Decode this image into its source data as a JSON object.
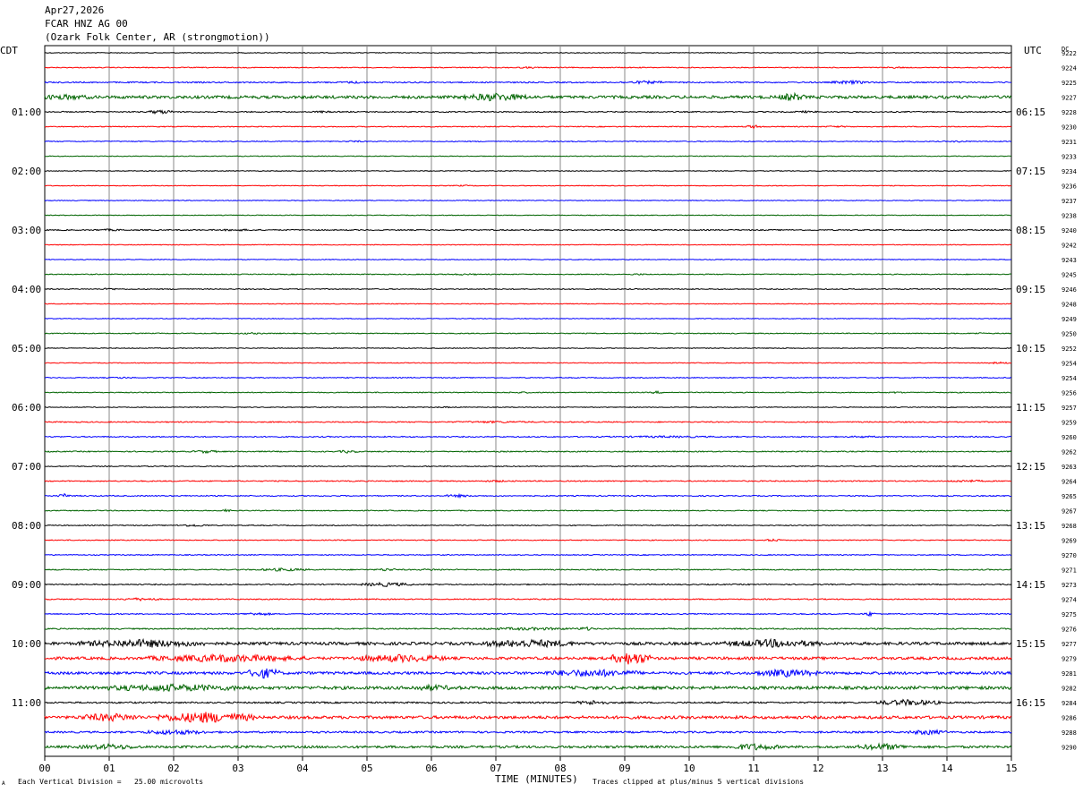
{
  "header": {
    "date": "Apr27,2026",
    "station": "FCAR HNZ AG 00",
    "location": "(Ozark Folk Center, AR (strongmotion))"
  },
  "left_timezone": "CDT",
  "right_timezone": "UTC",
  "dc_label": "DC",
  "footer": {
    "xlabel": "TIME (MINUTES)",
    "scale_note": "Each Vertical Division =   25.00 microvolts",
    "clip_note": "Traces clipped at plus/minus 5 vertical divisions",
    "corner_mark": "A"
  },
  "colors": {
    "trace_cycle": [
      "#000000",
      "#ff0000",
      "#0000ff",
      "#006400"
    ],
    "grid": "#888888"
  },
  "chart_data": {
    "type": "line",
    "title": "FCAR HNZ AG 00",
    "xlabel": "TIME (MINUTES)",
    "ylabel": "",
    "xlim": [
      0,
      15
    ],
    "x_ticks": [
      "00",
      "01",
      "02",
      "03",
      "04",
      "05",
      "06",
      "07",
      "08",
      "09",
      "10",
      "11",
      "12",
      "13",
      "14",
      "15"
    ],
    "left_hour_labels": [
      "01:00",
      "02:00",
      "03:00",
      "04:00",
      "05:00",
      "06:00",
      "07:00",
      "08:00",
      "09:00",
      "10:00",
      "11:00"
    ],
    "right_hour_labels": [
      "06:15",
      "07:15",
      "08:15",
      "09:15",
      "10:15",
      "11:15",
      "12:15",
      "13:15",
      "14:15",
      "15:15",
      "16:15"
    ],
    "dc_offsets": [
      "9222",
      "9224",
      "9225",
      "9227",
      "9228",
      "9230",
      "9231",
      "9233",
      "9234",
      "9236",
      "9237",
      "9238",
      "9240",
      "9242",
      "9243",
      "9245",
      "9246",
      "9248",
      "9249",
      "9250",
      "9252",
      "9254",
      "9254",
      "9256",
      "9257",
      "9259",
      "9260",
      "9262",
      "9263",
      "9264",
      "9265",
      "9267",
      "9268",
      "9269",
      "9270",
      "9271",
      "9273",
      "9274",
      "9275",
      "9276",
      "9277",
      "9279",
      "9281",
      "9282",
      "9284",
      "9286",
      "9288",
      "9290"
    ],
    "trace_activity": [
      {
        "base": 0.4,
        "bursts": []
      },
      {
        "base": 0.5,
        "bursts": [
          [
            7.5,
            0.5,
            2
          ],
          [
            13.2,
            0.4,
            2
          ]
        ]
      },
      {
        "base": 0.7,
        "bursts": [
          [
            4.8,
            0.5,
            2
          ],
          [
            9.3,
            0.8,
            2.5
          ],
          [
            12.5,
            0.6,
            3
          ]
        ]
      },
      {
        "base": 1.6,
        "bursts": [
          [
            0.3,
            1.0,
            2
          ],
          [
            7.0,
            1.0,
            3
          ],
          [
            11.6,
            0.4,
            3
          ]
        ]
      },
      {
        "base": 0.6,
        "bursts": [
          [
            1.8,
            0.4,
            4
          ],
          [
            4.3,
            0.4,
            2
          ],
          [
            11.8,
            0.5,
            2
          ]
        ]
      },
      {
        "base": 0.5,
        "bursts": [
          [
            11.0,
            0.3,
            4
          ],
          [
            12.3,
            0.5,
            2
          ]
        ]
      },
      {
        "base": 0.5,
        "bursts": [
          [
            4.8,
            0.4,
            2
          ],
          [
            14.2,
            0.4,
            2
          ]
        ]
      },
      {
        "base": 0.4,
        "bursts": []
      },
      {
        "base": 0.4,
        "bursts": []
      },
      {
        "base": 0.4,
        "bursts": [
          [
            6.5,
            0.5,
            2
          ]
        ]
      },
      {
        "base": 0.4,
        "bursts": []
      },
      {
        "base": 0.4,
        "bursts": []
      },
      {
        "base": 0.6,
        "bursts": [
          [
            1.0,
            0.6,
            2
          ],
          [
            3.0,
            0.8,
            2
          ]
        ]
      },
      {
        "base": 0.4,
        "bursts": []
      },
      {
        "base": 0.4,
        "bursts": []
      },
      {
        "base": 0.5,
        "bursts": [
          [
            6.5,
            0.6,
            2
          ],
          [
            9.2,
            0.3,
            2
          ]
        ]
      },
      {
        "base": 0.5,
        "bursts": [
          [
            1.0,
            0.2,
            3
          ]
        ]
      },
      {
        "base": 0.4,
        "bursts": []
      },
      {
        "base": 0.4,
        "bursts": []
      },
      {
        "base": 0.5,
        "bursts": [
          [
            3.2,
            0.6,
            2
          ],
          [
            14.5,
            0.3,
            2
          ]
        ]
      },
      {
        "base": 0.4,
        "bursts": [
          [
            11.5,
            0.2,
            2
          ]
        ]
      },
      {
        "base": 0.4,
        "bursts": [
          [
            14.8,
            0.3,
            3
          ]
        ]
      },
      {
        "base": 0.5,
        "bursts": [
          [
            1.2,
            0.5,
            2
          ]
        ]
      },
      {
        "base": 0.5,
        "bursts": [
          [
            7.4,
            0.5,
            2
          ],
          [
            9.5,
            0.2,
            3
          ],
          [
            13.2,
            0.3,
            2
          ]
        ]
      },
      {
        "base": 0.4,
        "bursts": [
          [
            6.2,
            0.4,
            2
          ]
        ]
      },
      {
        "base": 0.6,
        "bursts": [
          [
            7.0,
            1.6,
            2
          ]
        ]
      },
      {
        "base": 0.6,
        "bursts": [
          [
            9.6,
            2.0,
            2
          ],
          [
            12.7,
            0.5,
            2
          ]
        ]
      },
      {
        "base": 0.6,
        "bursts": [
          [
            2.5,
            0.4,
            3
          ],
          [
            4.7,
            0.3,
            3
          ]
        ]
      },
      {
        "base": 0.5,
        "bursts": []
      },
      {
        "base": 0.6,
        "bursts": [
          [
            7.0,
            0.5,
            2
          ],
          [
            14.3,
            0.6,
            2.5
          ]
        ]
      },
      {
        "base": 0.6,
        "bursts": [
          [
            0.3,
            0.2,
            4
          ],
          [
            6.4,
            0.4,
            3
          ]
        ]
      },
      {
        "base": 0.5,
        "bursts": [
          [
            2.8,
            0.2,
            3
          ]
        ]
      },
      {
        "base": 0.5,
        "bursts": [
          [
            2.3,
            0.5,
            3
          ]
        ]
      },
      {
        "base": 0.5,
        "bursts": [
          [
            11.3,
            0.3,
            3
          ]
        ]
      },
      {
        "base": 0.5,
        "bursts": []
      },
      {
        "base": 0.6,
        "bursts": [
          [
            3.7,
            0.8,
            3
          ],
          [
            5.3,
            0.3,
            3
          ],
          [
            6.0,
            0.5,
            2
          ]
        ]
      },
      {
        "base": 0.6,
        "bursts": [
          [
            5.3,
            0.8,
            4
          ]
        ]
      },
      {
        "base": 0.6,
        "bursts": [
          [
            1.5,
            0.6,
            3
          ]
        ]
      },
      {
        "base": 0.6,
        "bursts": [
          [
            3.3,
            0.5,
            3
          ],
          [
            12.8,
            0.2,
            4
          ]
        ]
      },
      {
        "base": 0.7,
        "bursts": [
          [
            7.5,
            1.5,
            2.5
          ],
          [
            8.4,
            0.3,
            3
          ]
        ]
      },
      {
        "base": 1.6,
        "bursts": [
          [
            1.5,
            2.0,
            3
          ],
          [
            7.5,
            1.5,
            3
          ],
          [
            11.3,
            1.5,
            3
          ]
        ]
      },
      {
        "base": 1.5,
        "bursts": [
          [
            2.8,
            2.5,
            3
          ],
          [
            5.5,
            1.5,
            3
          ],
          [
            9.1,
            0.6,
            5
          ]
        ]
      },
      {
        "base": 1.5,
        "bursts": [
          [
            3.4,
            0.5,
            4
          ],
          [
            8.5,
            1.5,
            3
          ],
          [
            11.5,
            1.0,
            3
          ]
        ]
      },
      {
        "base": 1.7,
        "bursts": [
          [
            2.0,
            2.5,
            2.5
          ],
          [
            6.0,
            1.0,
            2
          ]
        ]
      },
      {
        "base": 0.9,
        "bursts": [
          [
            8.5,
            0.5,
            3
          ],
          [
            13.4,
            1.0,
            4
          ]
        ]
      },
      {
        "base": 1.6,
        "bursts": [
          [
            1.0,
            1.0,
            3
          ],
          [
            2.5,
            1.5,
            4
          ]
        ]
      },
      {
        "base": 1.0,
        "bursts": [
          [
            2.0,
            1.0,
            3
          ],
          [
            13.7,
            0.6,
            3
          ]
        ]
      },
      {
        "base": 1.3,
        "bursts": [
          [
            1.0,
            1.0,
            2.5
          ],
          [
            11.0,
            0.8,
            3
          ],
          [
            13.0,
            0.8,
            3
          ]
        ]
      }
    ]
  }
}
